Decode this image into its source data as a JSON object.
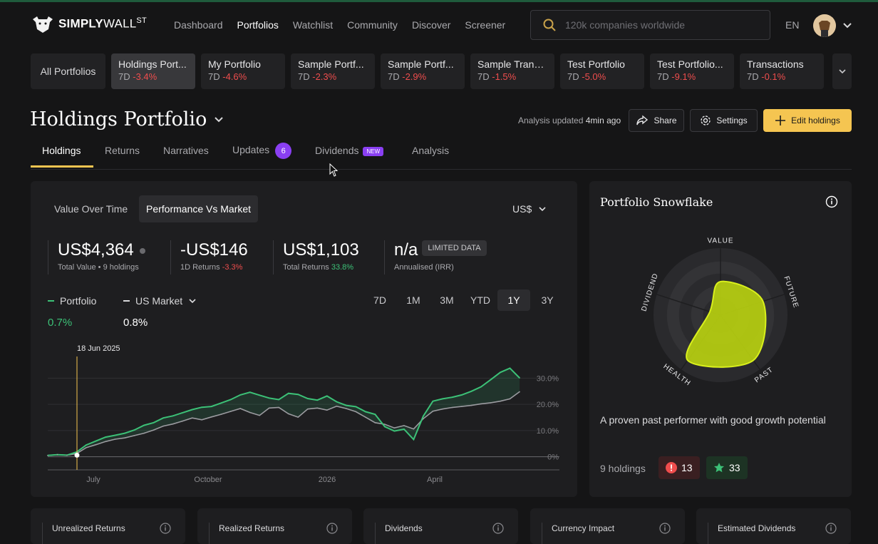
{
  "app": {
    "logo_main": "SIMPLY",
    "logo_thin": "WALL",
    "logo_sup": "ST"
  },
  "nav": {
    "links": [
      "Dashboard",
      "Portfolios",
      "Watchlist",
      "Community",
      "Discover",
      "Screener"
    ],
    "active": "Portfolios",
    "search_placeholder": "120k companies worldwide",
    "language": "EN"
  },
  "portfolio_strip": {
    "all_label": "All Portfolios",
    "items": [
      {
        "name": "Holdings Port...",
        "period": "7D",
        "change": "-3.4%"
      },
      {
        "name": "My Portfolio",
        "period": "7D",
        "change": "-4.6%"
      },
      {
        "name": "Sample Portf...",
        "period": "7D",
        "change": "-2.3%"
      },
      {
        "name": "Sample Portf...",
        "period": "7D",
        "change": "-2.9%"
      },
      {
        "name": "Sample Trans...",
        "period": "7D",
        "change": "-1.5%"
      },
      {
        "name": "Test Portfolio",
        "period": "7D",
        "change": "-5.0%"
      },
      {
        "name": "Test Portfolio...",
        "period": "7D",
        "change": "-9.1%"
      },
      {
        "name": "Transactions",
        "period": "7D",
        "change": "-0.1%"
      }
    ]
  },
  "header": {
    "title": "Holdings Portfolio",
    "updated_label": "Analysis updated",
    "updated_time": "4min ago",
    "share": "Share",
    "settings": "Settings",
    "edit": "Edit holdings"
  },
  "tabs": {
    "holdings": "Holdings",
    "returns": "Returns",
    "narratives": "Narratives",
    "updates": "Updates",
    "updates_count": "6",
    "dividends": "Dividends",
    "dividends_badge": "NEW",
    "analysis": "Analysis"
  },
  "main": {
    "toggle_value": "Value Over Time",
    "toggle_perf": "Performance Vs Market",
    "currency": "US$",
    "stats": {
      "total_value": "US$4,364",
      "total_value_label": "Total Value • 9 holdings",
      "one_day": "-US$146",
      "one_day_label": "1D Returns",
      "one_day_pct": "-3.3%",
      "total_returns": "US$1,103",
      "total_returns_label": "Total Returns",
      "total_returns_pct": "33.8%",
      "irr": "n/a",
      "irr_badge": "LIMITED DATA",
      "irr_label": "Annualised (IRR)"
    },
    "legend_portfolio": "Portfolio",
    "legend_market": "US Market",
    "portfolio_return": "0.7%",
    "market_return": "0.8%",
    "ranges": [
      "7D",
      "1M",
      "3M",
      "YTD",
      "1Y",
      "3Y"
    ],
    "active_range": "1Y",
    "crosshair_date": "18 Jun 2025"
  },
  "chart_data": {
    "type": "line",
    "x_ticks": [
      "July",
      "October",
      "2026",
      "April"
    ],
    "y_ticks": [
      "30.0%",
      "20.0%",
      "10.0%",
      "0%"
    ],
    "ylim": [
      -5,
      35
    ],
    "series": [
      {
        "name": "Portfolio",
        "color": "#3cc177",
        "values": [
          0.5,
          0.8,
          0.6,
          1.8,
          4.5,
          6,
          7.5,
          8.2,
          9,
          10.2,
          12,
          13,
          14.8,
          15.6,
          16.8,
          18,
          18.9,
          19.2,
          20.5,
          21.8,
          23.6,
          24.6,
          23.5,
          22.4,
          21.8,
          24.2,
          23.8,
          22.2,
          21.6,
          23.2,
          21,
          19.6,
          19.1,
          17.2,
          16.2,
          11.5,
          9.8,
          10.5,
          6.6,
          15.5,
          21.2,
          22.1,
          22.7,
          23.6,
          25,
          26.7,
          29.4,
          32.2,
          33.8,
          30.1
        ]
      },
      {
        "name": "US Market",
        "color": "#9b9ba0",
        "values": [
          0.5,
          0.8,
          0.6,
          1.2,
          3.5,
          4.6,
          5.8,
          6.7,
          7.2,
          8.1,
          9,
          10.2,
          11.7,
          12.5,
          13.6,
          14.8,
          14.1,
          15.2,
          16.2,
          17.3,
          18.4,
          16.9,
          15.8,
          18.6,
          18.8,
          16.4,
          15.1,
          18.2,
          18.6,
          17.8,
          19.3,
          18.4,
          17.2,
          15.1,
          13,
          12.4,
          11,
          11.9,
          10.6,
          14.5,
          17.4,
          18.2,
          18.8,
          19.2,
          19.6,
          20.2,
          20.6,
          21.2,
          22.1,
          24.8
        ]
      }
    ],
    "grid": true
  },
  "snowflake": {
    "title": "Portfolio Snowflake",
    "axes": [
      "VALUE",
      "FUTURE",
      "PAST",
      "HEALTH",
      "DIVIDEND"
    ],
    "scores": [
      3,
      4,
      5,
      5,
      1
    ],
    "max_score": 6,
    "color": "#b7cf10",
    "description": "A proven past performer with good growth potential",
    "holdings": "9 holdings",
    "risks": "13",
    "rewards": "33"
  },
  "bottom_cards": [
    "Unrealized Returns",
    "Realized Returns",
    "Dividends",
    "Currency Impact",
    "Estimated Dividends"
  ],
  "colors": {
    "accent": "#f5c551",
    "badge": "#8a3ff2",
    "positive": "#3cc177",
    "negative": "#ef4d4d"
  }
}
